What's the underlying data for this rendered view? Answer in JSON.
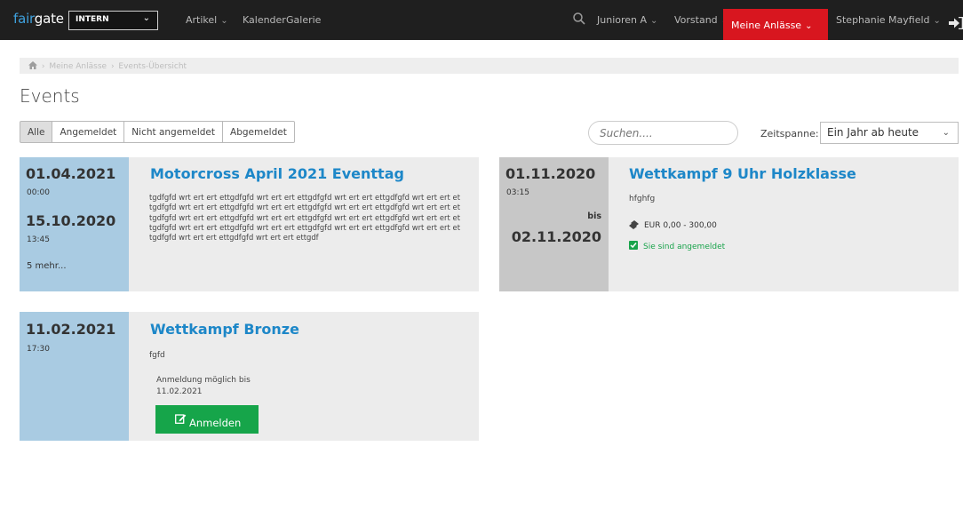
{
  "header": {
    "logo_part1": "fair",
    "logo_part2": "gate",
    "org_select": "INTERN",
    "nav": [
      {
        "label": "Artikel"
      },
      {
        "label": "Kalender"
      },
      {
        "label": "Galerie"
      }
    ],
    "right_nav": [
      {
        "label": "Junioren A"
      },
      {
        "label": "Vorstand"
      },
      {
        "label": "Meine Anlässe"
      },
      {
        "label": "Stephanie Mayfield"
      }
    ],
    "active_color": "#d8161f"
  },
  "breadcrumb": {
    "items": [
      "Meine Anlässe",
      "Events-Übersicht"
    ]
  },
  "page_title": "Events",
  "filters": [
    {
      "label": "Alle",
      "active": true
    },
    {
      "label": "Angemeldet",
      "active": false
    },
    {
      "label": "Nicht angemeldet",
      "active": false
    },
    {
      "label": "Abgemeldet",
      "active": false
    }
  ],
  "search": {
    "placeholder": "Suchen...."
  },
  "zeitspanne": {
    "label": "Zeitspanne:",
    "value": "Ein Jahr ab heute"
  },
  "events": [
    {
      "start_date": "01.04.2021",
      "start_time": "00:00",
      "end_date": "15.10.2020",
      "end_time": "13:45",
      "more": "5 mehr...",
      "title": "Motorcross April 2021 Eventtag",
      "description": "tgdfgfd wrt ert ert ettgdfgfd wrt ert ert ettgdfgfd wrt ert ert ettgdfgfd wrt ert ert ettgdfgfd wrt ert ert ettgdfgfd wrt ert ert ettgdfgfd wrt ert ert ettgdfgfd wrt ert ert ettgdfgfd wrt ert ert ettgdfgfd wrt ert ert ettgdfgfd wrt ert ert ettgdfgfd wrt ert ert ettgdfgfd wrt ert ert ettgdfgfd wrt ert ert ettgdfgfd wrt ert ert ettgdfgfd wrt ert ert ettgdfgfd wrt ert ert ettgdfgfd wrt ert ert ettgdf"
    },
    {
      "start_date": "01.11.2020",
      "start_time": "03:15",
      "bis": "bis",
      "end_date": "02.11.2020",
      "title": "Wettkampf 9 Uhr Holzklasse",
      "description": "hfghfg",
      "price": "EUR 0,00 - 300,00",
      "status": "Sie sind angemeldet"
    },
    {
      "start_date": "11.02.2021",
      "start_time": "17:30",
      "title": "Wettkampf Bronze",
      "description": "fgfd",
      "registration_note_line1": "Anmeldung möglich bis",
      "registration_note_line2": "11.02.2021",
      "button_label": "Anmelden"
    }
  ]
}
